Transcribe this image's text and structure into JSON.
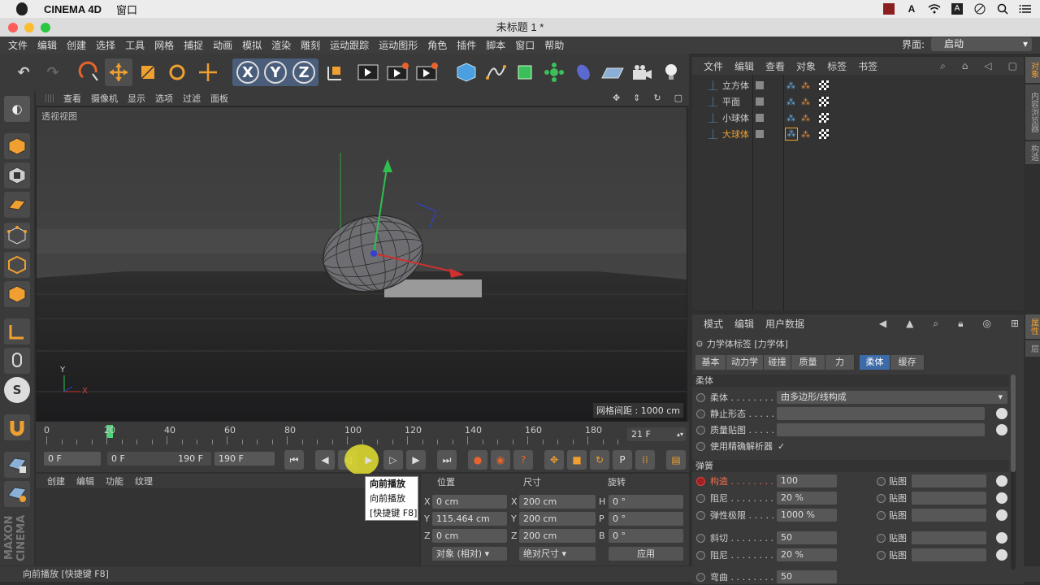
{
  "macbar": {
    "app": "CINEMA 4D",
    "window_menu": "窗口"
  },
  "window": {
    "title": "未标题 1 *"
  },
  "menu": {
    "items": [
      "文件",
      "编辑",
      "创建",
      "选择",
      "工具",
      "网格",
      "捕捉",
      "动画",
      "模拟",
      "渲染",
      "雕刻",
      "运动跟踪",
      "运动图形",
      "角色",
      "插件",
      "脚本",
      "窗口",
      "帮助"
    ],
    "layout_label": "界面:",
    "layout_value": "启动"
  },
  "toolbar": {
    "x_axis": "X",
    "y_axis": "Y",
    "z_axis": "Z"
  },
  "viewport": {
    "menu": [
      "查看",
      "摄像机",
      "显示",
      "选项",
      "过滤",
      "面板"
    ],
    "label": "透视视图",
    "grid_spacing": "网格间距 : 1000 cm",
    "axis_y": "Y",
    "axis_x": "X"
  },
  "timeline": {
    "ticks": [
      "0",
      "20",
      "40",
      "60",
      "80",
      "100",
      "120",
      "140",
      "160",
      "180"
    ],
    "current_frame_display": "21 F",
    "current_frame": 21,
    "max_frame": 190
  },
  "transport": {
    "start_field": "0 F",
    "range_start": "0 F",
    "range_end": "190 F",
    "end_field": "190 F"
  },
  "materials": {
    "menu": [
      "创建",
      "编辑",
      "功能",
      "纹理"
    ]
  },
  "tooltip": {
    "title": "向前播放",
    "line2": "向前播放",
    "line3": "[快捷键 F8]"
  },
  "coords": {
    "headers": [
      "位置",
      "尺寸",
      "旋转"
    ],
    "rows": [
      {
        "pos_axis": "X",
        "pos": "0 cm",
        "size_axis": "X",
        "size": "200 cm",
        "rot_axis": "H",
        "rot": "0 °"
      },
      {
        "pos_axis": "Y",
        "pos": "115.464 cm",
        "size_axis": "Y",
        "size": "200 cm",
        "rot_axis": "P",
        "rot": "0 °"
      },
      {
        "pos_axis": "Z",
        "pos": "0 cm",
        "size_axis": "Z",
        "size": "200 cm",
        "rot_axis": "B",
        "rot": "0 °"
      }
    ],
    "mode_select": "对象 (相对)",
    "size_select": "绝对尺寸",
    "apply": "应用"
  },
  "status": {
    "text": "向前播放 [快捷键 F8]"
  },
  "objects": {
    "menu": [
      "文件",
      "编辑",
      "查看",
      "对象",
      "标签",
      "书签"
    ],
    "items": [
      "立方体",
      "平面",
      "小球体",
      "大球体"
    ],
    "active_color": "#f0a030"
  },
  "attributes": {
    "menu": [
      "模式",
      "编辑",
      "用户数据"
    ],
    "tag_title": "力学体标签 [力学体]",
    "tabs": [
      "基本",
      "动力学",
      "碰撞",
      "质量",
      "力",
      "柔体",
      "缓存"
    ],
    "active_tab": "柔体",
    "section_softbody": "柔体",
    "softbody_label": "柔体 . . . . . . . . . .",
    "softbody_value": "由多边形/线构成",
    "rest_state": "静止形态 . . . . . .",
    "mass_map": "质量贴图 . . . . . .",
    "exact_solver": "使用精确解析器",
    "exact_solver_check": "✓",
    "section_spring": "弹簧",
    "springs": [
      {
        "label": "构造 . . . . . . . .",
        "value": "100",
        "map": "贴图"
      },
      {
        "label": "阻尼 . . . . . . . .",
        "value": "20 %",
        "map": "贴图"
      },
      {
        "label": "弹性极限 . . . . .",
        "value": "1000 %",
        "map": "贴图"
      },
      {
        "label": "斜切 . . . . . . . .",
        "value": "50",
        "map": "贴图"
      },
      {
        "label": "阻尼 . . . . . . . .",
        "value": "20 %",
        "map": "贴图"
      },
      {
        "label": "弯曲 . . . . . . . .",
        "value": "50",
        "map": ""
      }
    ]
  },
  "sidetabs": {
    "objects": "对象",
    "content": "内容浏览器",
    "structure": "构造",
    "attributes": "属性",
    "layers": "层"
  },
  "colors": {
    "accent": "#4a6e9a",
    "active_tab": "#3d6ba8",
    "orange": "#f0a030"
  }
}
